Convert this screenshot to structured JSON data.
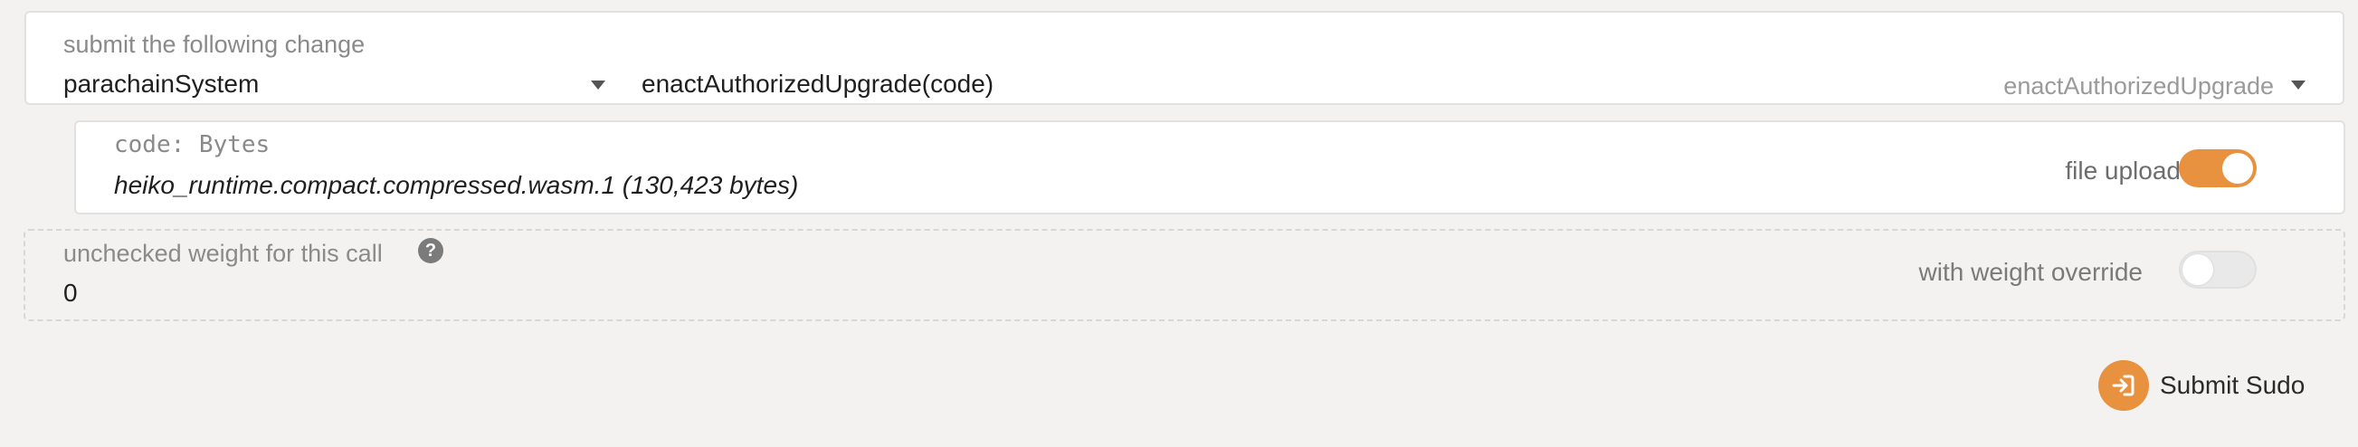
{
  "call": {
    "label": "submit the following change",
    "section": "parachainSystem",
    "method": "enactAuthorizedUpgrade(code)",
    "method_short": "enactAuthorizedUpgrade"
  },
  "param": {
    "label": "code: Bytes",
    "value": "heiko_runtime.compact.compressed.wasm.1 (130,423 bytes)",
    "file_upload_label": "file upload",
    "file_upload_enabled": true
  },
  "weight": {
    "label": "unchecked weight for this call",
    "help_icon": "?",
    "value": "0",
    "override_label": "with weight override",
    "override_enabled": false
  },
  "submit": {
    "label": "Submit Sudo",
    "icon": "sign-in-icon"
  },
  "colors": {
    "accent": "#e8913e",
    "background": "#f3f2f1"
  }
}
